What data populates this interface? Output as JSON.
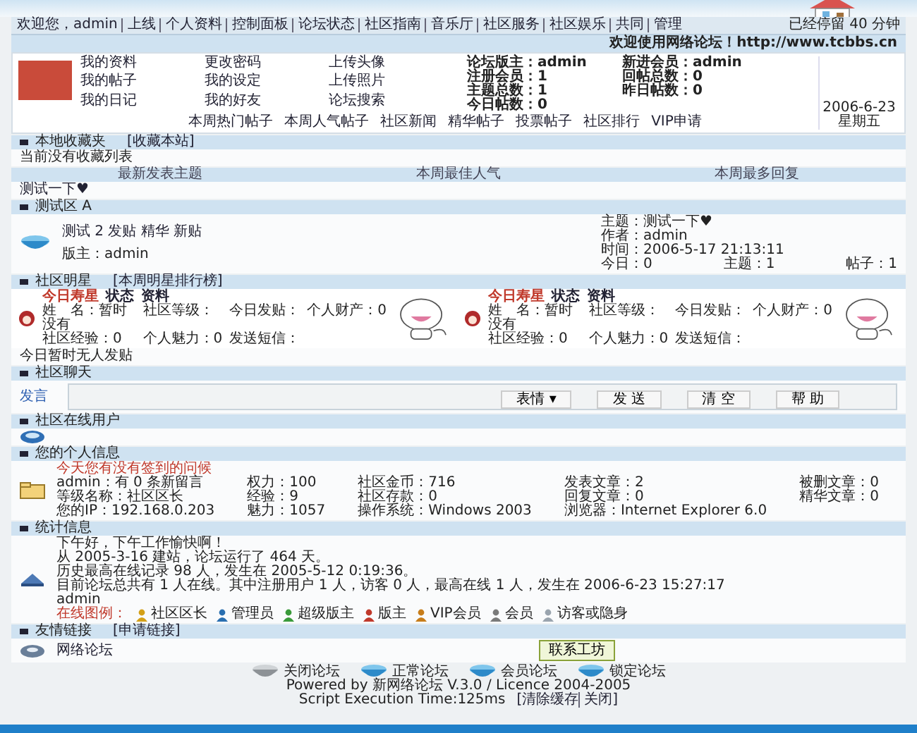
{
  "nav": {
    "items": [
      "欢迎您，admin",
      "上线",
      "个人资料",
      "控制面板",
      "论坛状态",
      "社区指南",
      "音乐厅",
      "社区服务",
      "社区娱乐",
      "共同",
      "管理"
    ],
    "stay_time": "已经停留 40 分钟"
  },
  "welcome": "欢迎使用网络论坛！http://www.tcbbs.cn",
  "user_panel": {
    "links": [
      "我的资料",
      "更改密码",
      "上传头像",
      "我的帖子",
      "我的设定",
      "上传照片",
      "我的日记",
      "我的好友",
      "论坛搜索"
    ],
    "stats": [
      "论坛版主：admin",
      "新进会员：admin",
      "注册会员：1",
      "回帖总数：0",
      "主题总数：1",
      "昨日帖数：0",
      "今日帖数：0"
    ],
    "date": "2006-6-23",
    "weekday": "星期五"
  },
  "quick_links": [
    "本周热门帖子",
    "本周人气帖子",
    "社区新闻",
    "精华帖子",
    "投票帖子",
    "社区排行",
    "VIP申请"
  ],
  "favorites": {
    "title": "本地收藏夹",
    "action": "[收藏本站]",
    "empty_text": "当前没有收藏列表"
  },
  "top_tabs": [
    "最新发表主题",
    "本周最佳人气",
    "本周最多回复"
  ],
  "hot_topic": "测试一下♥",
  "category": {
    "title": "测试区 A",
    "forums": [
      {
        "name": "测试 2 发贴 精华 新贴",
        "moderator": "版主：admin",
        "last_post": [
          "主题：测试一下♥",
          "作者：admin",
          "时间：2006-5-17 21:13:11"
        ],
        "counts": [
          "今日：0",
          "主题：1",
          "帖子：1"
        ]
      }
    ]
  },
  "stars": {
    "title": "社区明星",
    "subtitle": "[本周明星排行榜]",
    "no_post": "今日暂时无人发贴",
    "cards": [
      {
        "title": "今日寿星",
        "links": [
          "状态",
          "资料"
        ],
        "fields": [
          "姓　名：暂时没有",
          "社区等级：",
          "今日发贴：",
          "个人财产：0",
          "社区经验：0",
          "个人魅力：0",
          "发送短信："
        ]
      },
      {
        "title": "今日寿星",
        "links": [
          "状态",
          "资料"
        ],
        "fields": [
          "姓　名：暂时没有",
          "社区等级：",
          "今日发贴：",
          "个人财产：0",
          "社区经验：0",
          "个人魅力：0",
          "发送短信："
        ]
      }
    ]
  },
  "chat": {
    "title": "社区聊天",
    "label": "发言",
    "buttons": [
      "表情 ▾",
      "发 送",
      "清 空",
      "帮 助"
    ]
  },
  "online": {
    "title": "社区在线用户"
  },
  "personal": {
    "title": "您的个人信息",
    "notice": "今天您有没有签到的问候",
    "fields": [
      "admin：有 0 条新留言",
      "权力：100",
      "社区金币：716",
      "发表文章：2",
      "被删文章：0",
      "等级名称：社区区长",
      "经验：9",
      "社区存款：0",
      "回复文章：0",
      "精华文章：0",
      "您的IP：192.168.0.203",
      "魅力：1057",
      "操作系统：Windows 2003",
      "浏览器：Internet Explorer 6.0"
    ]
  },
  "stats": {
    "title": "统计信息",
    "lines": [
      "下午好，下午工作愉快啊！",
      "从 2005-3-16 建站，论坛运行了 464 天。",
      "历史最高在线记录 98 人，发生在 2005-5-12 0:19:36。",
      "目前论坛总共有 1 人在线。其中注册用户 1 人，访客 0 人，最高在线 1 人，发生在 2006-6-23 15:27:17"
    ],
    "user": "admin",
    "legend_label": "在线图例：",
    "legend": [
      {
        "label": "社区区长",
        "color": "#d4a017"
      },
      {
        "label": "管理员",
        "color": "#2a6fb0"
      },
      {
        "label": "超级版主",
        "color": "#3a9a3a"
      },
      {
        "label": "版主",
        "color": "#c0392b"
      },
      {
        "label": "VIP会员",
        "color": "#c77d1a"
      },
      {
        "label": "会员",
        "color": "#7a7a7a"
      },
      {
        "label": "访客或隐身",
        "color": "#9aa4ae"
      }
    ]
  },
  "links": {
    "title": "友情链接",
    "action": "[申请链接]",
    "items": [
      "网络论坛"
    ],
    "button": "联系工坊"
  },
  "footer": {
    "states": [
      "关闭论坛",
      "正常论坛",
      "会员论坛",
      "锁定论坛"
    ],
    "powered": "Powered by 新网络论坛 V.3.0 / Licence 2004-2005",
    "exec_time": "Script Execution Time:125ms",
    "actions": [
      "[清除缓存",
      "关闭]"
    ]
  }
}
